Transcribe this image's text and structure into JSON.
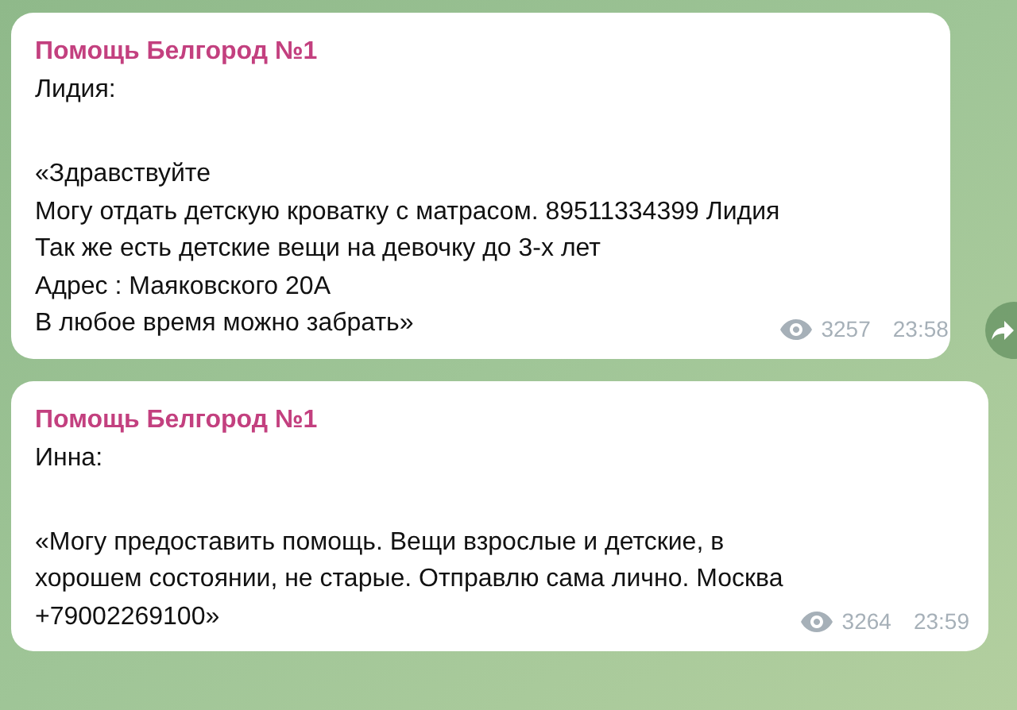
{
  "messages": [
    {
      "sender": "Помощь Белгород №1",
      "author": "Лидия:",
      "body": "«Здравствуйте\nМогу отдать детскую кроватку с матрасом. 89511334399 Лидия\nТак же есть детские вещи на девочку до 3-х лет\nАдрес : Маяковского 20А\nВ любое время можно забрать»",
      "views": "3257",
      "time": "23:58"
    },
    {
      "sender": "Помощь Белгород №1",
      "author": "Инна:",
      "body": "«Могу предоставить помощь. Вещи взрослые и детские, в\nхорошем состоянии, не старые. Отправлю сама лично. Москва\n+79002269100»",
      "views": "3264",
      "time": "23:59"
    }
  ]
}
